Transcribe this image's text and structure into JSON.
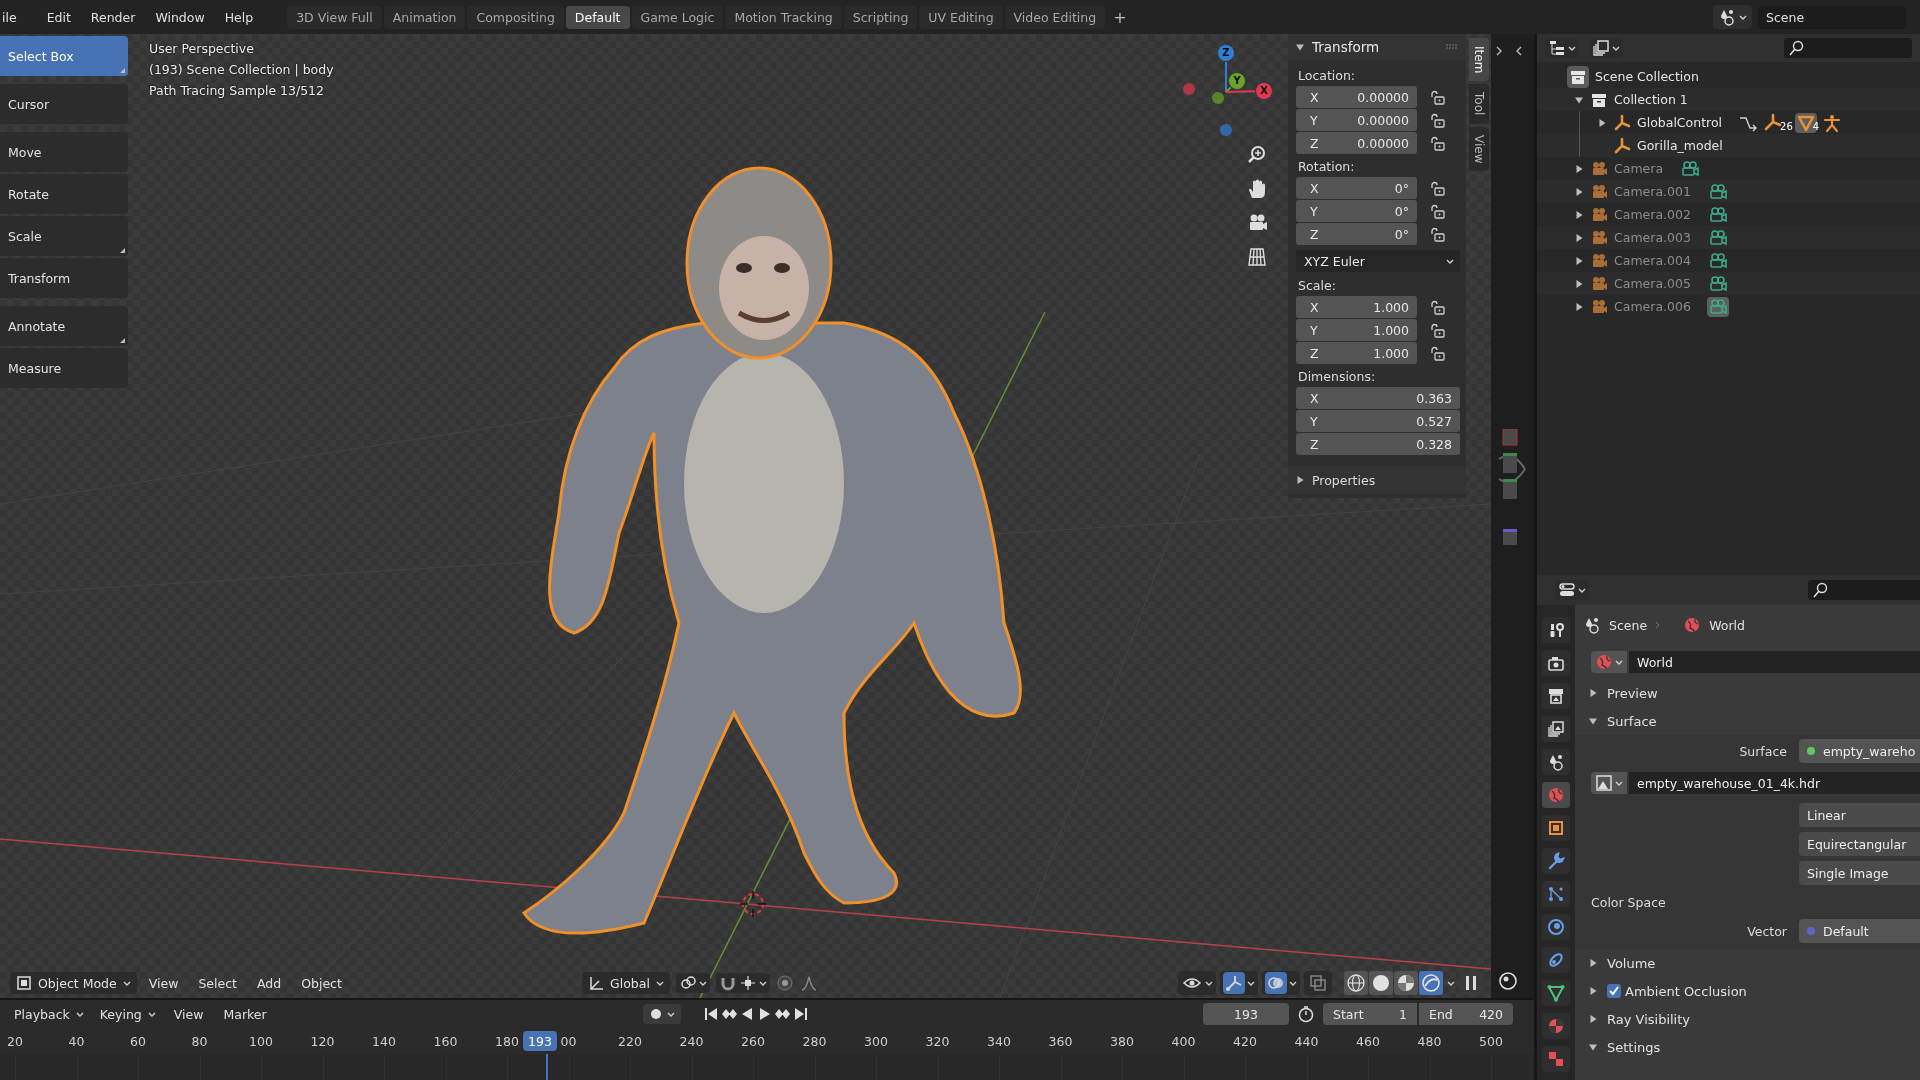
{
  "menu": [
    "ile",
    "Edit",
    "Render",
    "Window",
    "Help"
  ],
  "workspaces": [
    {
      "label": "3D View Full",
      "selected": false
    },
    {
      "label": "Animation",
      "selected": false
    },
    {
      "label": "Compositing",
      "selected": false
    },
    {
      "label": "Default",
      "selected": true
    },
    {
      "label": "Game Logic",
      "selected": false
    },
    {
      "label": "Motion Tracking",
      "selected": false
    },
    {
      "label": "Scripting",
      "selected": false
    },
    {
      "label": "UV Editing",
      "selected": false
    },
    {
      "label": "Video Editing",
      "selected": false
    }
  ],
  "add_workspace": "+",
  "scene": "Scene",
  "toolbar": [
    {
      "label": "Select Box",
      "selected": true,
      "more": true
    },
    {
      "label": "Cursor",
      "selected": false,
      "more": false
    },
    {
      "label": "Move",
      "selected": false,
      "more": false
    },
    {
      "label": "Rotate",
      "selected": false,
      "more": false
    },
    {
      "label": "Scale",
      "selected": false,
      "more": true
    },
    {
      "label": "Transform",
      "selected": false,
      "more": false
    },
    {
      "label": "Annotate",
      "selected": false,
      "more": true
    },
    {
      "label": "Measure",
      "selected": false,
      "more": false
    }
  ],
  "overlay": [
    "User Perspective",
    "(193) Scene Collection | body",
    "Path Tracing Sample 13/512"
  ],
  "gizmo": {
    "axes": [
      {
        "label": "Z",
        "color": "#2f7fd8"
      },
      {
        "label": "Y",
        "color": "#6ba22a"
      },
      {
        "label": "X",
        "color": "#e0384e"
      }
    ]
  },
  "sidebar": {
    "tabs": [
      {
        "label": "Item",
        "selected": true
      },
      {
        "label": "Tool",
        "selected": false
      },
      {
        "label": "View",
        "selected": false
      }
    ],
    "transform": {
      "title": "Transform",
      "expanded": true,
      "groups": [
        {
          "label": "Location:",
          "fields": [
            {
              "axis": "X",
              "value": "0.00000",
              "locked": false
            },
            {
              "axis": "Y",
              "value": "0.00000",
              "locked": false
            },
            {
              "axis": "Z",
              "value": "0.00000",
              "locked": false
            }
          ]
        },
        {
          "label": "Rotation:",
          "mode": "XYZ Euler",
          "fields": [
            {
              "axis": "X",
              "value": "0°",
              "locked": false
            },
            {
              "axis": "Y",
              "value": "0°",
              "locked": false
            },
            {
              "axis": "Z",
              "value": "0°",
              "locked": false
            }
          ]
        },
        {
          "label": "Scale:",
          "fields": [
            {
              "axis": "X",
              "value": "1.000",
              "locked": false
            },
            {
              "axis": "Y",
              "value": "1.000",
              "locked": false
            },
            {
              "axis": "Z",
              "value": "1.000",
              "locked": false
            }
          ]
        },
        {
          "label": "Dimensions:",
          "fields": [
            {
              "axis": "X",
              "value": "0.363"
            },
            {
              "axis": "Y",
              "value": "0.527"
            },
            {
              "axis": "Z",
              "value": "0.328"
            }
          ]
        }
      ]
    },
    "properties": {
      "title": "Properties",
      "expanded": false
    }
  },
  "viewport_header": {
    "mode": "Object Mode",
    "menus": [
      "View",
      "Select",
      "Add",
      "Object"
    ],
    "orientation": "Global",
    "toggles": [
      {
        "kind": "visibility",
        "on": false
      },
      {
        "kind": "gizmos",
        "on": true
      },
      {
        "kind": "overlays",
        "on": true
      },
      {
        "kind": "xray",
        "on": false
      }
    ],
    "shading": [
      {
        "kind": "wireframe",
        "selected": false
      },
      {
        "kind": "solid",
        "selected": false
      },
      {
        "kind": "material",
        "selected": false
      },
      {
        "kind": "rendered",
        "selected": true
      }
    ]
  },
  "timeline": {
    "dropdowns": [
      "Playback",
      "Keying"
    ],
    "menus": [
      "View",
      "Marker"
    ],
    "current_frame": "193",
    "start_label": "Start",
    "start": "1",
    "end_label": "End",
    "end": "420",
    "ruler": [
      "20",
      "40",
      "60",
      "80",
      "100",
      "120",
      "140",
      "160",
      "180",
      "00",
      "220",
      "240",
      "260",
      "280",
      "300",
      "320",
      "340",
      "360",
      "380",
      "400",
      "420",
      "440",
      "460",
      "480",
      "500"
    ],
    "playhead": "193"
  },
  "outliner": {
    "rows": [
      {
        "label": "Scene Collection",
        "kind": "scene_collection",
        "hidden": false,
        "children": [
          {
            "label": "Collection 1",
            "kind": "collection",
            "hidden": false,
            "expanded": true,
            "children": [
              {
                "label": "GlobalControl",
                "kind": "armature",
                "hidden": false,
                "expanded": false,
                "extras": [
                  {
                    "kind": "constraint",
                    "highlighted": false
                  },
                  {
                    "kind": "armature_data",
                    "count": "26",
                    "highlighted": false
                  },
                  {
                    "kind": "mesh",
                    "count": "4",
                    "highlighted": true
                  },
                  {
                    "kind": "pose",
                    "highlighted": false
                  }
                ]
              },
              {
                "label": "Gorilla_model",
                "kind": "armature",
                "hidden": false
              }
            ]
          },
          {
            "label": "Camera",
            "kind": "camera",
            "hidden": true,
            "expanded": false,
            "extras": [
              {
                "kind": "camera_data",
                "highlighted": false
              }
            ]
          },
          {
            "label": "Camera.001",
            "kind": "camera",
            "hidden": true,
            "expanded": false,
            "extras": [
              {
                "kind": "camera_data",
                "highlighted": false
              }
            ]
          },
          {
            "label": "Camera.002",
            "kind": "camera",
            "hidden": true,
            "expanded": false,
            "extras": [
              {
                "kind": "camera_data",
                "highlighted": false
              }
            ]
          },
          {
            "label": "Camera.003",
            "kind": "camera",
            "hidden": true,
            "expanded": false,
            "extras": [
              {
                "kind": "camera_data",
                "highlighted": false
              }
            ]
          },
          {
            "label": "Camera.004",
            "kind": "camera",
            "hidden": true,
            "expanded": false,
            "extras": [
              {
                "kind": "camera_data",
                "highlighted": false
              }
            ]
          },
          {
            "label": "Camera.005",
            "kind": "camera",
            "hidden": true,
            "expanded": false,
            "extras": [
              {
                "kind": "camera_data",
                "highlighted": false
              }
            ]
          },
          {
            "label": "Camera.006",
            "kind": "camera",
            "hidden": true,
            "expanded": false,
            "extras": [
              {
                "kind": "camera_data",
                "highlighted": true
              }
            ]
          }
        ]
      }
    ]
  },
  "properties_editor": {
    "tabs": [
      {
        "kind": "tool",
        "selected": false
      },
      {
        "kind": "render",
        "selected": false
      },
      {
        "kind": "output",
        "selected": false
      },
      {
        "kind": "view_layer",
        "selected": false
      },
      {
        "kind": "scene",
        "selected": false
      },
      {
        "kind": "world",
        "selected": true
      },
      {
        "kind": "object",
        "selected": false
      },
      {
        "kind": "modifiers",
        "selected": false
      },
      {
        "kind": "particles",
        "selected": false
      },
      {
        "kind": "physics",
        "selected": false
      },
      {
        "kind": "constraints",
        "selected": false
      },
      {
        "kind": "data",
        "selected": false
      },
      {
        "kind": "material",
        "selected": false
      },
      {
        "kind": "texture",
        "selected": false
      }
    ],
    "breadcrumb": [
      "Scene",
      "World"
    ],
    "world_field": "World",
    "panels": [
      {
        "title": "Preview",
        "expanded": false
      },
      {
        "title": "Surface",
        "expanded": true,
        "rows": [
          {
            "kind": "socket",
            "label": "Surface",
            "value": "empty_wareho",
            "color": "#63c763"
          },
          {
            "kind": "image",
            "value": "empty_warehouse_01_4k.hdr"
          },
          {
            "kind": "dropdown",
            "value": "Linear"
          },
          {
            "kind": "dropdown",
            "value": "Equirectangular"
          },
          {
            "kind": "dropdown",
            "value": "Single Image"
          },
          {
            "kind": "heading",
            "label": "Color Space"
          },
          {
            "kind": "socket",
            "label": "Vector",
            "value": "Default",
            "color": "#6363c7"
          }
        ]
      },
      {
        "title": "Volume",
        "expanded": false
      },
      {
        "title": "Ambient Occlusion",
        "expanded": false,
        "checked": true
      },
      {
        "title": "Ray Visibility",
        "expanded": false
      },
      {
        "title": "Settings",
        "expanded": true
      }
    ]
  }
}
